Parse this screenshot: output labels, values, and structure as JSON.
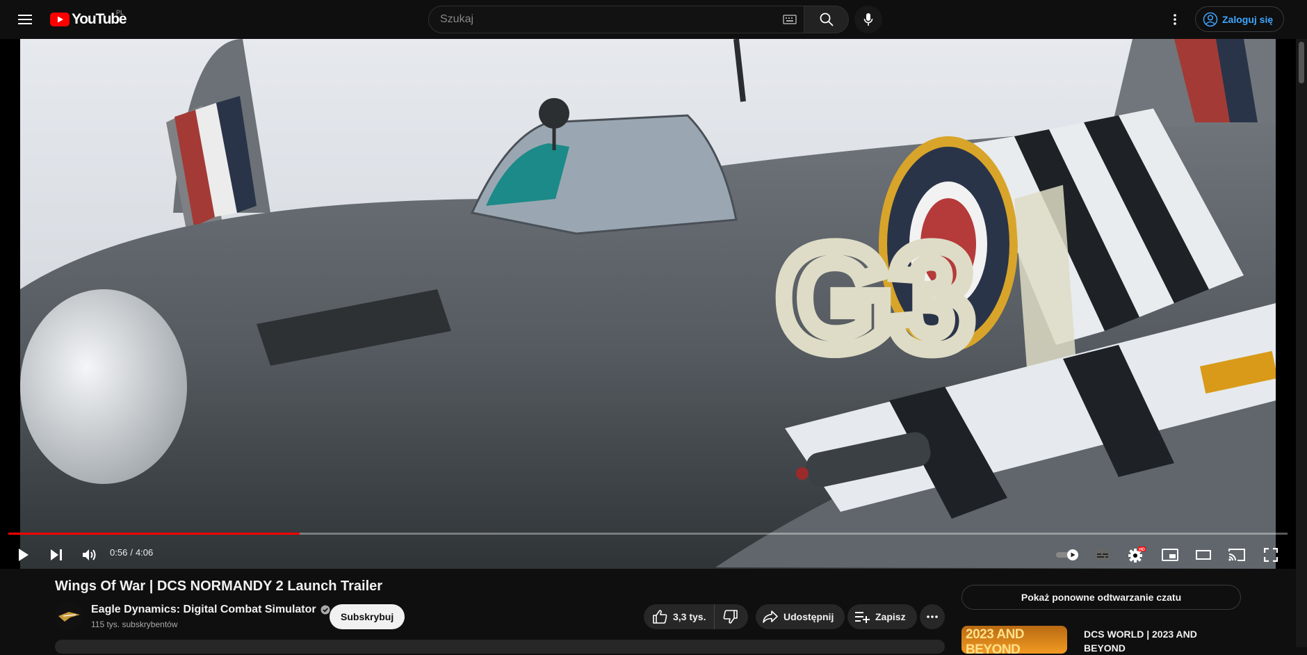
{
  "header": {
    "logo_text": "YouTube",
    "region": "PL",
    "search_placeholder": "Szukaj",
    "signin_label": "Zaloguj się"
  },
  "player": {
    "current_time": "0:56",
    "separator": "/",
    "duration": "4:06",
    "progress_fraction": 0.2276,
    "hd_badge": "HD"
  },
  "video": {
    "title": "Wings Of War | DCS NORMANDY 2 Launch Trailer",
    "channel_name": "Eagle Dynamics: Digital Combat Simulator",
    "subscribers": "115 tys. subskrybentów",
    "subscribe_label": "Subskrybuj",
    "likes": "3,3 tys.",
    "share_label": "Udostępnij",
    "save_label": "Zapisz",
    "aircraft_code": "G3"
  },
  "sidebar": {
    "chat_replay_label": "Pokaż ponowne odtwarzanie czatu",
    "recommendation": {
      "thumb_text": "2023 AND BEYOND",
      "title": "DCS WORLD | 2023 AND BEYOND"
    }
  },
  "colors": {
    "accent_red": "#ff0000",
    "link_blue": "#3ea6ff",
    "background": "#0f0f0f"
  }
}
